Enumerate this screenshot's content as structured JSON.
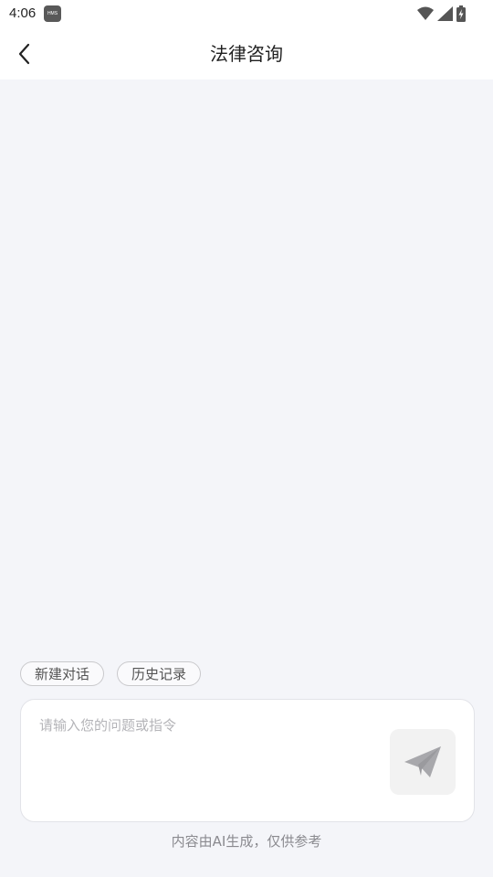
{
  "status_bar": {
    "time": "4:06",
    "badge_text": "HMS",
    "icons": [
      "wifi-icon",
      "cellular-signal-icon",
      "battery-charging-icon"
    ]
  },
  "app_bar": {
    "back_icon": "chevron-left-icon",
    "title": "法律咨询"
  },
  "chips": {
    "new_chat": "新建对话",
    "history": "历史记录"
  },
  "composer": {
    "placeholder": "请输入您的问题或指令",
    "value": "",
    "send_icon": "paper-plane-icon"
  },
  "footer": {
    "disclaimer": "内容由AI生成，仅供参考"
  },
  "colors": {
    "background": "#f4f5f9",
    "surface": "#ffffff",
    "send_button_bg": "#f2f2f2",
    "send_icon": "#a8a8ac",
    "chip_border": "#c9c9cc"
  }
}
